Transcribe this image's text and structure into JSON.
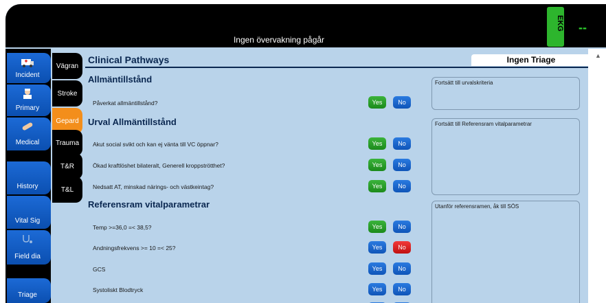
{
  "header": {
    "status": "Ingen övervakning pågår",
    "ekg_label": "EKG",
    "ekg_value": "--"
  },
  "main_nav": [
    {
      "label": "Incident",
      "icon": "ambulance-icon"
    },
    {
      "label": "Primary",
      "icon": "nurse-icon"
    },
    {
      "label": "Medical",
      "icon": "bandage-icon"
    },
    {
      "label": "History",
      "icon": ""
    },
    {
      "label": "Vital Sig",
      "icon": ""
    },
    {
      "label": "Field dia",
      "icon": "stethoscope-icon"
    },
    {
      "label": "Triage",
      "icon": ""
    }
  ],
  "sub_nav": [
    {
      "label": "Vägran",
      "active": false
    },
    {
      "label": "Stroke",
      "active": false
    },
    {
      "label": "Gepard",
      "active": true
    },
    {
      "label": "Trauma",
      "active": false
    },
    {
      "label": "T&R",
      "active": false
    },
    {
      "label": "T&L",
      "active": false
    }
  ],
  "page": {
    "title": "Clinical Pathways",
    "triage_label": "Ingen Triage"
  },
  "sections": [
    {
      "heading": "Allmäntillstånd",
      "questions": [
        {
          "text": "Påverkat allmäntillstånd?",
          "yes": "Yes",
          "no": "No",
          "selected": "yes"
        }
      ],
      "info": "Fortsätt till urvalskriteria"
    },
    {
      "heading": "Urval Allmäntillstånd",
      "questions": [
        {
          "text": "Akut social svikt och kan ej vänta till VC öppnar?",
          "yes": "Yes",
          "no": "No",
          "selected": "yes"
        },
        {
          "text": "Ökad kraftlöshet bilateralt, Generell kroppströtthet?",
          "yes": "Yes",
          "no": "No",
          "selected": "yes"
        },
        {
          "text": "Nedsatt AT, minskad närings- och västkeintag?",
          "yes": "Yes",
          "no": "No",
          "selected": "yes"
        }
      ],
      "info": "Fortsätt till Referensram vitalparametrar"
    },
    {
      "heading": "Referensram vitalparametrar",
      "questions": [
        {
          "text": "Temp >=36,0 =< 38,5?",
          "yes": "Yes",
          "no": "No",
          "selected": "yes"
        },
        {
          "text": "Andningsfrekvens >= 10 =< 25?",
          "yes": "Yes",
          "no": "No",
          "selected": "no"
        },
        {
          "text": "GCS",
          "yes": "Yes",
          "no": "No",
          "selected": ""
        },
        {
          "text": "Systoliskt Blodtryck",
          "yes": "Yes",
          "no": "No",
          "selected": ""
        }
      ],
      "info": "Utanför referensramen, åk till SÖS"
    }
  ],
  "colors": {
    "accent_active": "#f38e1b",
    "nav_blue": "#1c6ad6",
    "yes_green": "#2aa02a",
    "no_red": "#e02424",
    "background": "#b9d3ea"
  }
}
